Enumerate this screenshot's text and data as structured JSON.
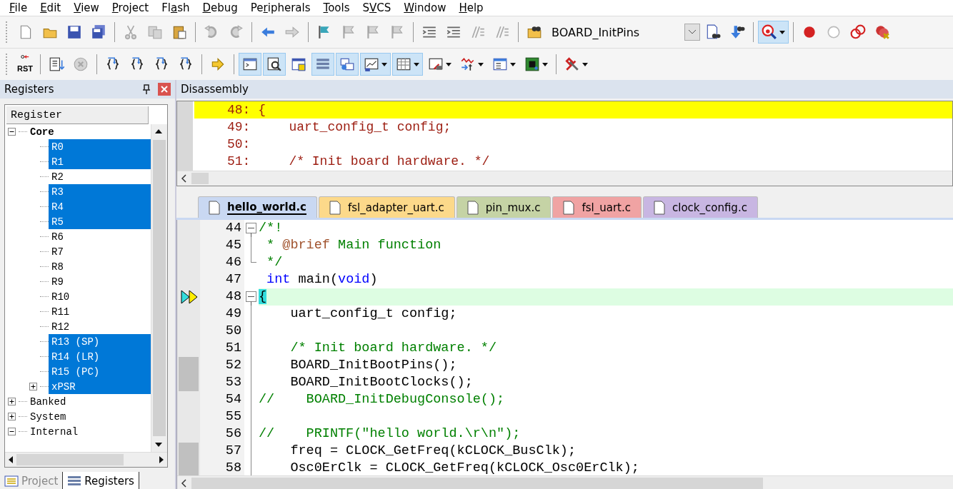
{
  "menu": [
    {
      "key": "F",
      "post": "ile"
    },
    {
      "key": "E",
      "post": "dit"
    },
    {
      "key": "V",
      "post": "iew"
    },
    {
      "key": "P",
      "post": "roject"
    },
    {
      "pre": "Fl",
      "key": "a",
      "post": "sh"
    },
    {
      "key": "D",
      "post": "ebug"
    },
    {
      "pre": "Pe",
      "key": "r",
      "post": "ipherals"
    },
    {
      "key": "T",
      "post": "ools"
    },
    {
      "pre": "S",
      "key": "V",
      "post": "CS"
    },
    {
      "key": "W",
      "post": "indow"
    },
    {
      "key": "H",
      "post": "elp"
    }
  ],
  "toolbar_1": [
    [
      {
        "kind": "new-file",
        "disabled": false
      },
      {
        "kind": "folder",
        "disabled": false
      },
      {
        "kind": "save",
        "disabled": false
      },
      {
        "kind": "save-all",
        "disabled": false
      }
    ],
    [
      {
        "kind": "scissors",
        "disabled": true
      },
      {
        "kind": "copy",
        "disabled": true
      },
      {
        "kind": "paste",
        "disabled": false
      }
    ],
    [
      {
        "kind": "undo",
        "disabled": true
      },
      {
        "kind": "redo",
        "disabled": true
      }
    ],
    [
      {
        "kind": "back",
        "disabled": false
      },
      {
        "kind": "forward",
        "disabled": true
      }
    ],
    [
      {
        "kind": "flag",
        "disabled": false
      },
      {
        "kind": "flag-prev",
        "disabled": true
      },
      {
        "kind": "flag-next",
        "disabled": true
      },
      {
        "kind": "flag-clear",
        "disabled": true
      }
    ],
    [
      {
        "kind": "indent",
        "disabled": false
      },
      {
        "kind": "outdent",
        "disabled": false
      },
      {
        "kind": "comment",
        "disabled": true
      },
      {
        "kind": "uncomment",
        "disabled": true
      }
    ],
    [
      {
        "kind": "find-folder",
        "disabled": false
      },
      {
        "kind": "combo",
        "value": "BOARD_InitPins"
      },
      {
        "kind": "find-doc",
        "disabled": false
      },
      {
        "kind": "find-arrow",
        "disabled": false
      }
    ],
    [
      {
        "kind": "debug",
        "disabled": false,
        "pressed": true,
        "dropdown": true
      }
    ],
    [
      {
        "kind": "breakpoint",
        "disabled": false
      },
      {
        "kind": "breakpoint-empty",
        "disabled": false
      },
      {
        "kind": "breakpoint-pair",
        "disabled": false
      },
      {
        "kind": "breakpoint-cross",
        "disabled": false
      }
    ]
  ],
  "toolbar_2": [
    [
      {
        "kind": "reset",
        "label": "RST",
        "disabled": false
      }
    ],
    [
      {
        "kind": "step-list",
        "disabled": false
      },
      {
        "kind": "stop",
        "disabled": true
      }
    ],
    [
      {
        "kind": "step-into",
        "disabled": false
      },
      {
        "kind": "step-over",
        "disabled": false
      },
      {
        "kind": "step-out",
        "disabled": false
      },
      {
        "kind": "run-to",
        "disabled": false
      }
    ],
    [
      {
        "kind": "next-statement",
        "disabled": false
      }
    ],
    [
      {
        "kind": "console",
        "pressed": true
      },
      {
        "kind": "disassembly",
        "pressed": true
      },
      {
        "kind": "symbols",
        "pressed": false
      },
      {
        "kind": "registers",
        "pressed": true
      },
      {
        "kind": "call-stack",
        "pressed": true
      },
      {
        "kind": "watch",
        "pressed": true,
        "dropdown": true
      },
      {
        "kind": "memory",
        "pressed": true,
        "dropdown": true
      },
      {
        "kind": "serial",
        "pressed": false,
        "dropdown": true
      },
      {
        "kind": "analyzer",
        "pressed": false,
        "dropdown": true
      },
      {
        "kind": "viewer",
        "pressed": false,
        "dropdown": true
      },
      {
        "kind": "chip",
        "pressed": false,
        "dropdown": true
      }
    ],
    [
      {
        "kind": "tools",
        "pressed": false,
        "dropdown": true
      }
    ]
  ],
  "registers_panel": {
    "title": "Registers",
    "column": "Register",
    "tree": [
      {
        "label": "Core",
        "bold": true,
        "expanded": true,
        "selected": false,
        "children": [
          {
            "label": "R0",
            "selected": true
          },
          {
            "label": "R1",
            "selected": true
          },
          {
            "label": "R2",
            "selected": false
          },
          {
            "label": "R3",
            "selected": true
          },
          {
            "label": "R4",
            "selected": true
          },
          {
            "label": "R5",
            "selected": true
          },
          {
            "label": "R6",
            "selected": false
          },
          {
            "label": "R7",
            "selected": false
          },
          {
            "label": "R8",
            "selected": false
          },
          {
            "label": "R9",
            "selected": false
          },
          {
            "label": "R10",
            "selected": false
          },
          {
            "label": "R11",
            "selected": false
          },
          {
            "label": "R12",
            "selected": false
          },
          {
            "label": "R13 (SP)",
            "selected": true
          },
          {
            "label": "R14 (LR)",
            "selected": true
          },
          {
            "label": "R15 (PC)",
            "selected": true
          },
          {
            "label": "xPSR",
            "selected": true,
            "expanded": false
          }
        ]
      },
      {
        "label": "Banked",
        "bold": false,
        "expanded": false,
        "selected": false
      },
      {
        "label": "System",
        "bold": false,
        "expanded": false,
        "selected": false
      },
      {
        "label": "Internal",
        "bold": false,
        "expanded": true,
        "selected": false
      }
    ],
    "tabs": [
      {
        "label": "Project",
        "selected": false
      },
      {
        "label": "Registers",
        "selected": true
      }
    ]
  },
  "disassembly": {
    "title": "Disassembly",
    "lines": [
      {
        "text": "48: {",
        "current": true
      },
      {
        "text": "49:     uart_config_t config;",
        "current": false
      },
      {
        "text": "50:",
        "current": false
      },
      {
        "text": "51:     /* Init board hardware. */",
        "current": false
      }
    ]
  },
  "editor": {
    "tabs": [
      {
        "label": "hello_world.c",
        "selected": true,
        "color": "#c9d8f2"
      },
      {
        "label": "fsl_adapter_uart.c",
        "selected": false,
        "color": "#fcd98a"
      },
      {
        "label": "pin_mux.c",
        "selected": false,
        "color": "#c5d3a5"
      },
      {
        "label": "fsl_uart.c",
        "selected": false,
        "color": "#f0a3a3"
      },
      {
        "label": "clock_config.c",
        "selected": false,
        "color": "#c8b6e2"
      }
    ],
    "lines": [
      {
        "number": "44",
        "kind": "fold-start",
        "current": false,
        "has_code": false,
        "segments": [
          {
            "text": "/*!",
            "kind": "comment"
          }
        ]
      },
      {
        "number": "45",
        "kind": "fold-body",
        "current": false,
        "has_code": false,
        "segments": [
          {
            "text": " * ",
            "kind": "comment"
          },
          {
            "text": "@brief",
            "kind": "doc"
          },
          {
            "text": " Main function",
            "kind": "comment"
          }
        ]
      },
      {
        "number": "46",
        "kind": "fold-end",
        "current": false,
        "has_code": false,
        "segments": [
          {
            "text": " */",
            "kind": "comment"
          }
        ]
      },
      {
        "number": "47",
        "kind": "plain",
        "current": false,
        "has_code": false,
        "segments": [
          {
            "text": " int",
            "kind": "keyword"
          },
          {
            "text": " main(",
            "kind": "code"
          },
          {
            "text": "void",
            "kind": "keyword"
          },
          {
            "text": ")",
            "kind": "code"
          }
        ]
      },
      {
        "number": "48",
        "kind": "fold-start",
        "current": true,
        "has_code": false,
        "segments": [
          {
            "text": "{",
            "kind": "brace"
          }
        ]
      },
      {
        "number": "49",
        "kind": "fold-body",
        "current": false,
        "has_code": false,
        "segments": [
          {
            "text": "    uart_config_t config;",
            "kind": "code"
          }
        ]
      },
      {
        "number": "50",
        "kind": "fold-body",
        "current": false,
        "has_code": false
      },
      {
        "number": "51",
        "kind": "fold-body",
        "current": false,
        "has_code": false,
        "segments": [
          {
            "text": "    /* Init board hardware. */",
            "kind": "comment"
          }
        ]
      },
      {
        "number": "52",
        "kind": "fold-body",
        "current": false,
        "has_code": true,
        "segments": [
          {
            "text": "    BOARD_InitBootPins();",
            "kind": "code"
          }
        ]
      },
      {
        "number": "53",
        "kind": "fold-body",
        "current": false,
        "has_code": true,
        "segments": [
          {
            "text": "    BOARD_InitBootClocks();",
            "kind": "code"
          }
        ]
      },
      {
        "number": "54",
        "kind": "fold-body",
        "current": false,
        "has_code": false,
        "segments": [
          {
            "text": "//    BOARD_InitDebugConsole();",
            "kind": "comment"
          }
        ]
      },
      {
        "number": "55",
        "kind": "fold-body",
        "current": false,
        "has_code": false
      },
      {
        "number": "56",
        "kind": "fold-body",
        "current": false,
        "has_code": false,
        "segments": [
          {
            "text": "//    PRINTF(\"hello world.\\r\\n\");",
            "kind": "comment"
          }
        ]
      },
      {
        "number": "57",
        "kind": "fold-body",
        "current": false,
        "has_code": true,
        "segments": [
          {
            "text": "    freq = CLOCK_GetFreq(kCLOCK_BusClk);",
            "kind": "code"
          }
        ]
      },
      {
        "number": "58",
        "kind": "fold-body",
        "current": false,
        "has_code": true,
        "segments": [
          {
            "text": "    Osc0ErClk = CLOCK_GetFreq(kCLOCK_Osc0ErClk);",
            "kind": "code"
          }
        ]
      }
    ]
  }
}
